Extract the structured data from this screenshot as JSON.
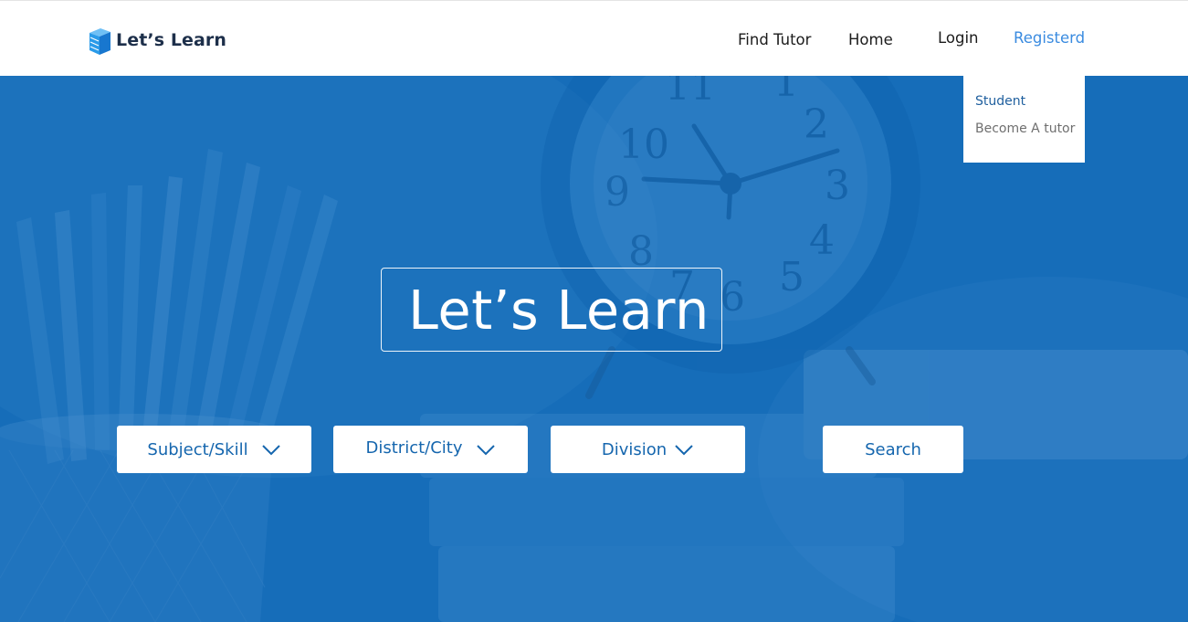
{
  "brand": {
    "name": "Let’s Learn",
    "icon": "book-logo-icon"
  },
  "nav": {
    "find_tutor": "Find Tutor",
    "home": "Home",
    "login": "Login",
    "register": "Registerd"
  },
  "register_menu": {
    "items": [
      {
        "label": "Student"
      },
      {
        "label": "Become A tutor"
      }
    ]
  },
  "hero": {
    "title": "Let’s Learn"
  },
  "filters": {
    "subject": "Subject/Skill",
    "district": "District/City",
    "division": "Division",
    "search": "Search",
    "chevron_icon": "chevron-down-icon"
  },
  "colors": {
    "brand_dark": "#1d2f4a",
    "accent": "#3a8be0",
    "hero_blue": "#1570bc",
    "control_text": "#1566ae"
  }
}
